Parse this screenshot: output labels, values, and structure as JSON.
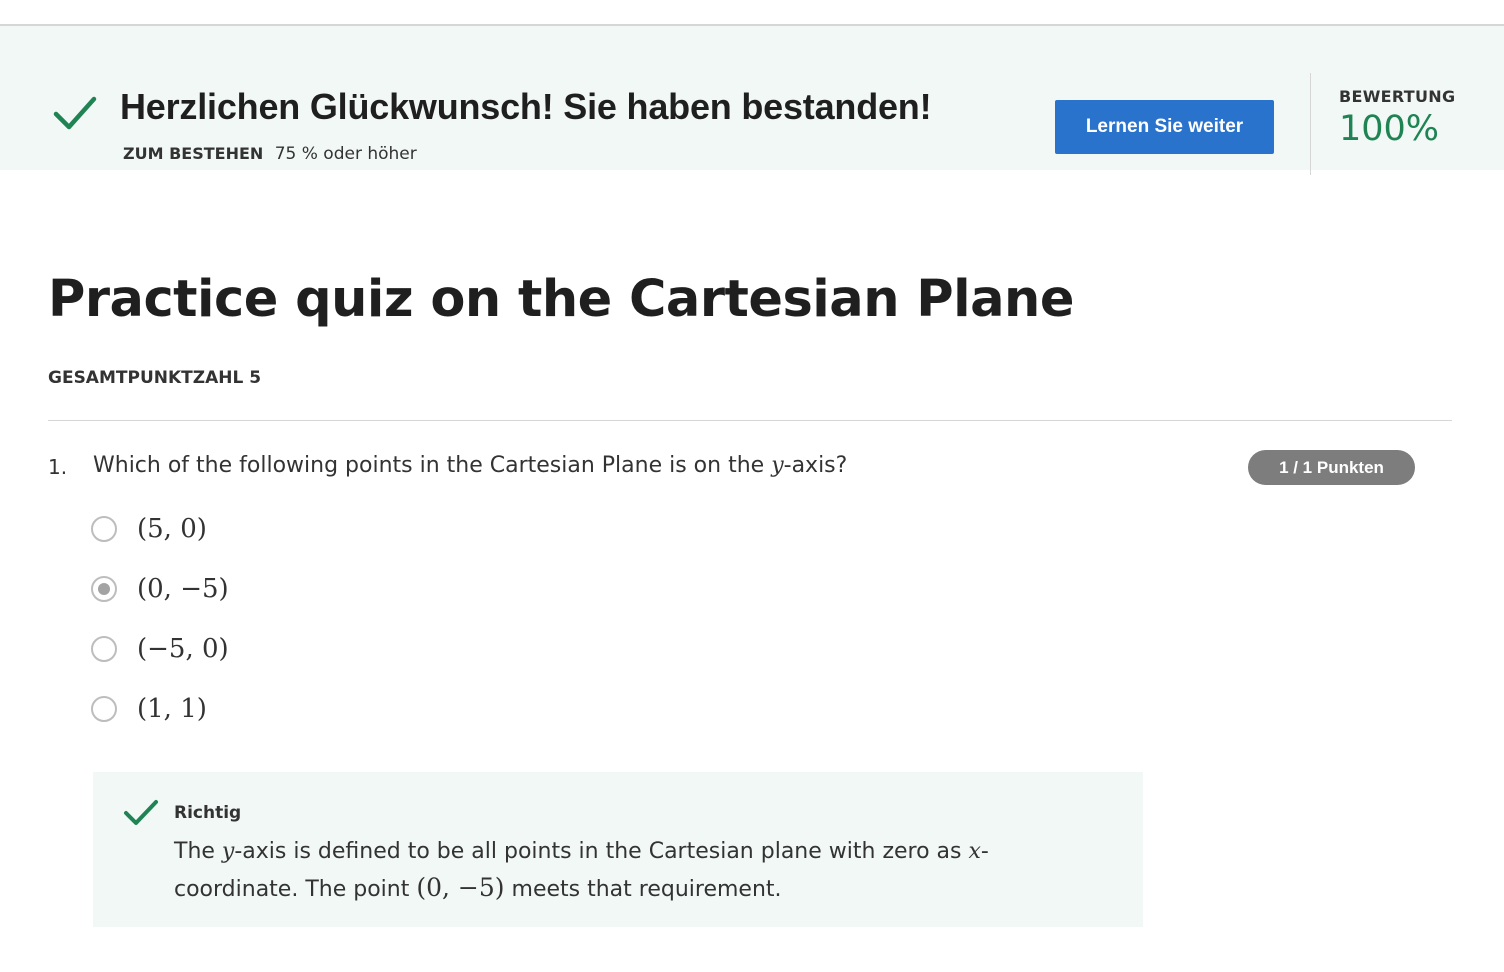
{
  "banner": {
    "title": "Herzlichen Glückwunsch! Sie haben bestanden!",
    "pass_label": "ZUM BESTEHEN",
    "pass_value": "75 % oder höher",
    "continue_button": "Lernen Sie weiter",
    "grade_label": "BEWERTUNG",
    "grade_value": "100%"
  },
  "quiz": {
    "title": "Practice quiz on the Cartesian Plane",
    "total_points": "GESAMTPUNKTZAHL 5"
  },
  "question": {
    "number": "1.",
    "text_before": "Which of the following points in the Cartesian Plane is on the ",
    "text_var": "y",
    "text_after": "-axis?",
    "points": "1 / 1 Punkten",
    "options": [
      {
        "label": "(5, 0)",
        "selected": false
      },
      {
        "label": "(0, −5)",
        "selected": true
      },
      {
        "label": "(−5, 0)",
        "selected": false
      },
      {
        "label": "(1, 1)",
        "selected": false
      }
    ]
  },
  "feedback": {
    "title": "Richtig",
    "p1": "The ",
    "var_y": "y",
    "p2": "-axis is defined to be all points in the Cartesian plane with zero as ",
    "var_x": "x",
    "p3": "-coordinate. The point ",
    "point": "(0, −5)",
    "p4": " meets that requirement."
  },
  "colors": {
    "banner_bg": "#f1f8f6",
    "success_green": "#1f8354",
    "button_blue": "#2a73cc",
    "pill_gray": "#7d7d7d"
  }
}
